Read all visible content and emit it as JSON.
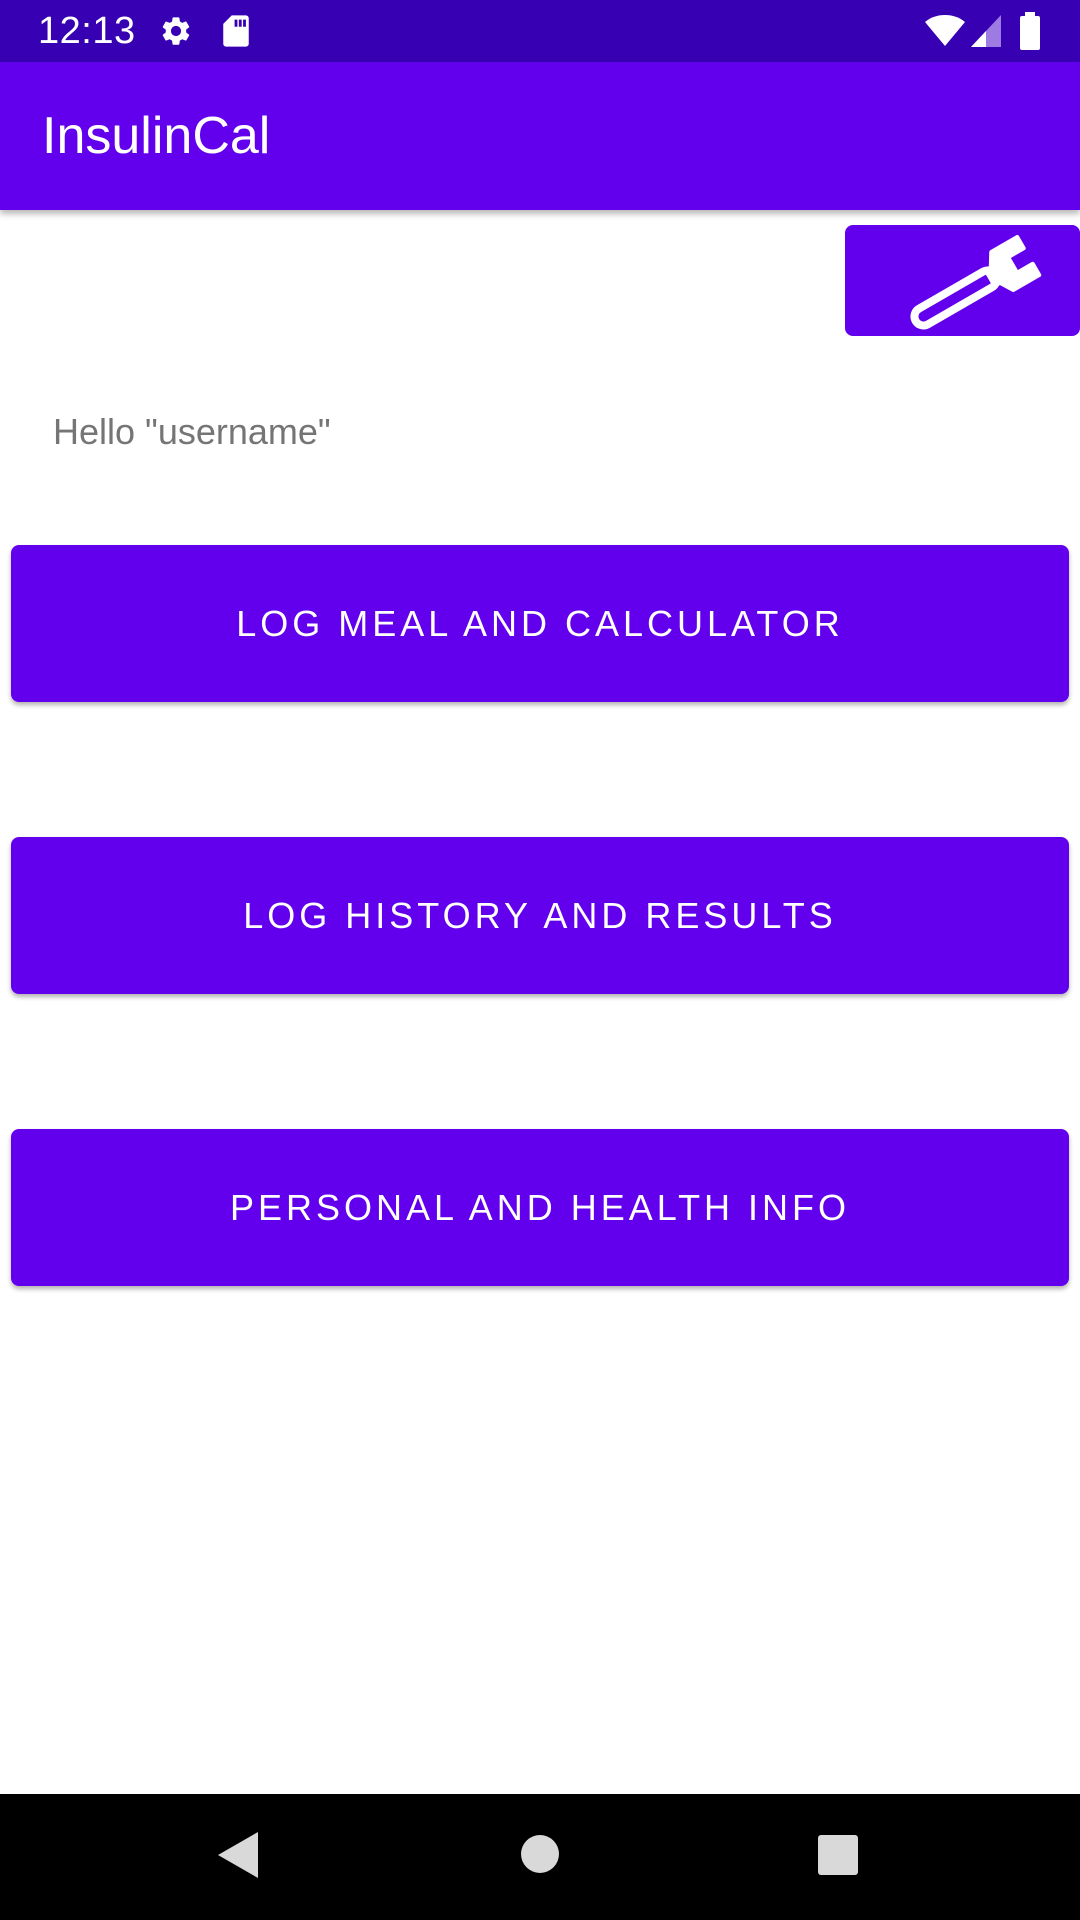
{
  "status_bar": {
    "time": "12:13",
    "icons": [
      "gear-icon",
      "sd-card-icon",
      "wifi-icon",
      "cell-signal-icon",
      "battery-icon"
    ]
  },
  "app_bar": {
    "title": "InsulinCal"
  },
  "main": {
    "settings_button_icon": "wrench-icon",
    "greeting": "Hello \"username\"",
    "buttons": [
      {
        "label": "LOG MEAL AND CALCULATOR"
      },
      {
        "label": "LOG HISTORY AND RESULTS"
      },
      {
        "label": "PERSONAL AND HEALTH INFO"
      }
    ]
  },
  "nav_bar": {
    "icons": [
      "back-icon",
      "home-icon",
      "recents-icon"
    ]
  },
  "colors": {
    "status_bar": "#3700B3",
    "primary": "#6200EE",
    "greeting_text": "#757575",
    "nav_bar": "#000000"
  }
}
